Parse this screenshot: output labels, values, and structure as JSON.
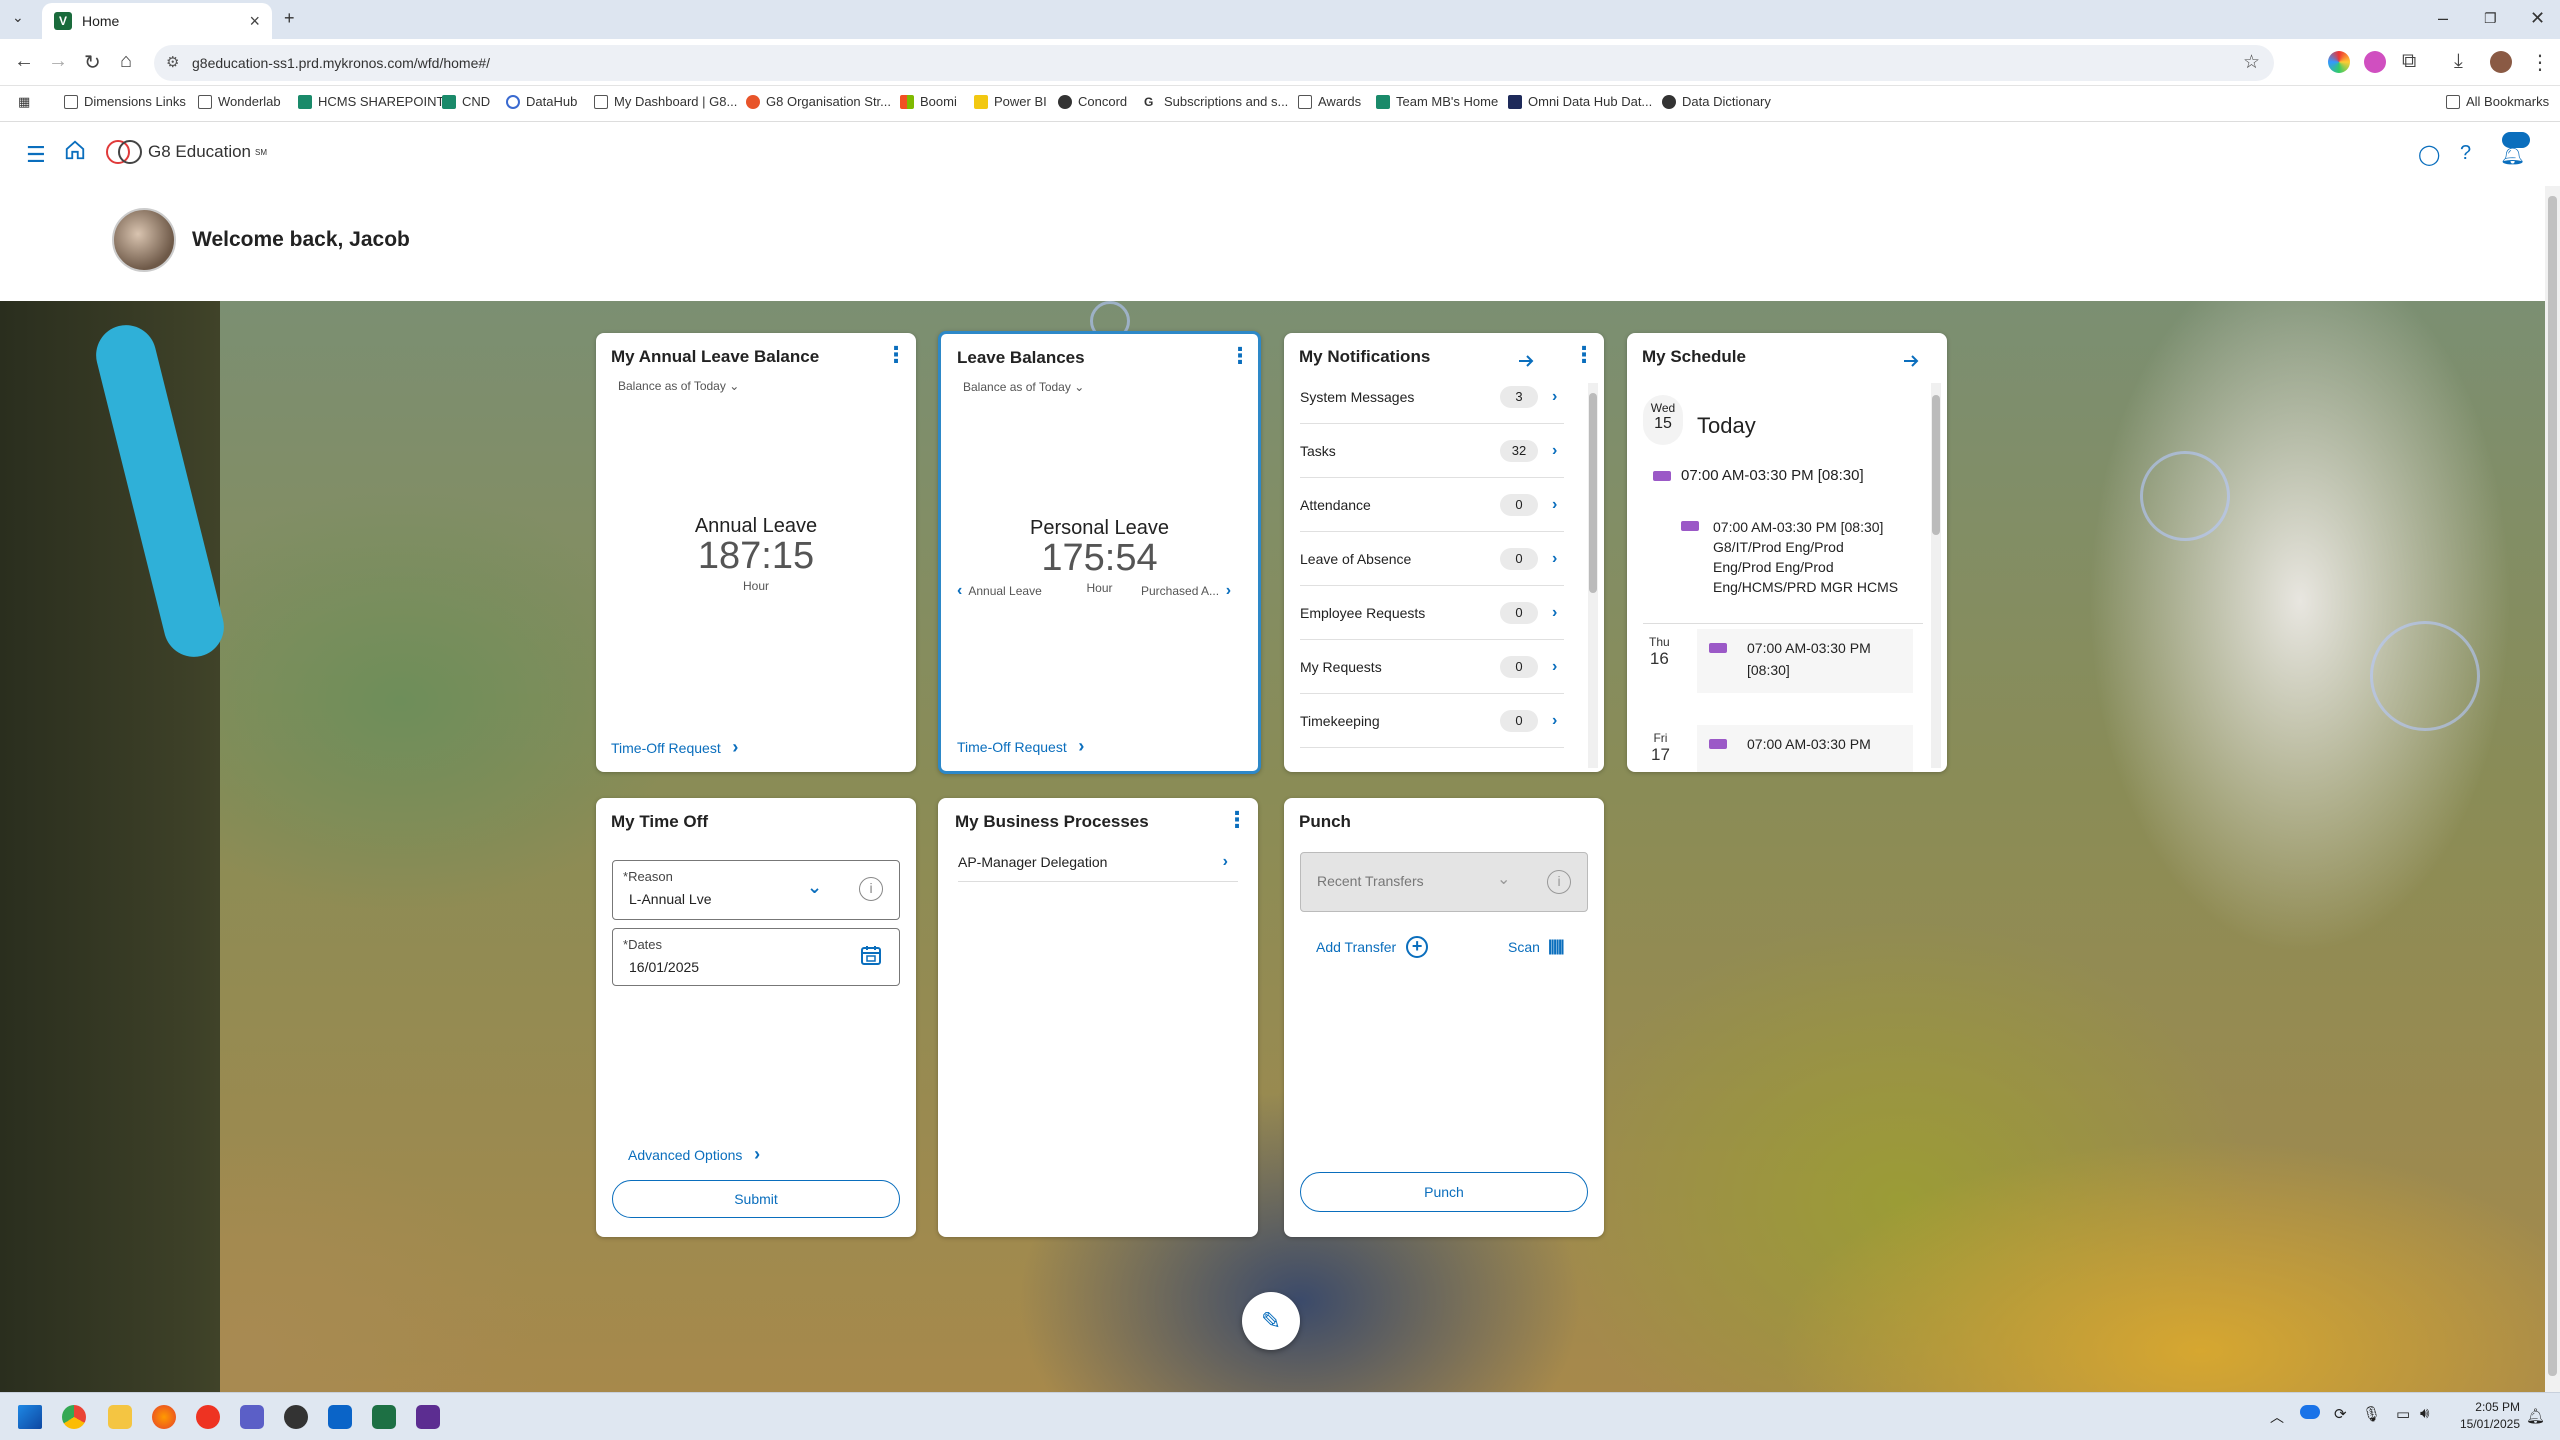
{
  "browser": {
    "tab_title": "Home",
    "url": "g8education-ss1.prd.mykronos.com/wfd/home#/",
    "bookmarks": [
      "Dimensions Links",
      "Wonderlab",
      "HCMS SHAREPOINT",
      "CND",
      "DataHub",
      "My Dashboard | G8...",
      "G8 Organisation Str...",
      "Boomi",
      "Power BI",
      "Concord",
      "Subscriptions and s...",
      "Awards",
      "Team MB's Home",
      "Omni Data Hub Dat...",
      "Data Dictionary"
    ],
    "all_bookmarks": "All Bookmarks"
  },
  "app": {
    "brand": "G8 Education",
    "brand_mark": "SM",
    "welcome": "Welcome back, Jacob"
  },
  "annual_leave_card": {
    "title": "My Annual Leave Balance",
    "subtitle": "Balance as of Today",
    "leave_name": "Annual Leave",
    "value": "187:15",
    "unit": "Hour",
    "link": "Time-Off Request"
  },
  "leave_balances_card": {
    "title": "Leave Balances",
    "subtitle": "Balance as of Today",
    "leave_name": "Personal Leave",
    "value": "175:54",
    "unit": "Hour",
    "prev_label": "Annual Leave",
    "next_label": "Purchased A...",
    "link": "Time-Off Request"
  },
  "notifications_card": {
    "title": "My Notifications",
    "items": [
      {
        "label": "System Messages",
        "count": "3"
      },
      {
        "label": "Tasks",
        "count": "32"
      },
      {
        "label": "Attendance",
        "count": "0"
      },
      {
        "label": "Leave of Absence",
        "count": "0"
      },
      {
        "label": "Employee Requests",
        "count": "0"
      },
      {
        "label": "My Requests",
        "count": "0"
      },
      {
        "label": "Timekeeping",
        "count": "0"
      }
    ]
  },
  "schedule_card": {
    "title": "My Schedule",
    "today": {
      "dow": "Wed",
      "day": "15",
      "label": "Today",
      "shift": "07:00 AM-03:30 PM [08:30]",
      "detail_time": "07:00 AM-03:30 PM [08:30]",
      "detail_org": "G8/IT/Prod Eng/Prod Eng/Prod Eng/Prod Eng/HCMS/PRD MGR HCMS"
    },
    "days": [
      {
        "dow": "Thu",
        "day": "16",
        "shift": "07:00 AM-03:30 PM",
        "hours": "[08:30]"
      },
      {
        "dow": "Fri",
        "day": "17",
        "shift": "07:00 AM-03:30 PM",
        "hours": ""
      }
    ]
  },
  "time_off_card": {
    "title": "My Time Off",
    "reason_label": "Reason",
    "reason_value": "L-Annual Lve",
    "dates_label": "Dates",
    "dates_value": "16/01/2025",
    "required_mark": "*",
    "advanced": "Advanced Options",
    "submit": "Submit"
  },
  "business_card": {
    "title": "My Business Processes",
    "items": [
      "AP-Manager Delegation"
    ]
  },
  "punch_card": {
    "title": "Punch",
    "transfers_placeholder": "Recent Transfers",
    "add_transfer": "Add Transfer",
    "scan": "Scan",
    "punch_button": "Punch"
  },
  "taskbar": {
    "time": "2:05 PM",
    "date": "15/01/2025"
  },
  "colors": {
    "accent": "#0a6ebd",
    "shift": "#9b59c7",
    "selected_border": "#2d88c8"
  }
}
